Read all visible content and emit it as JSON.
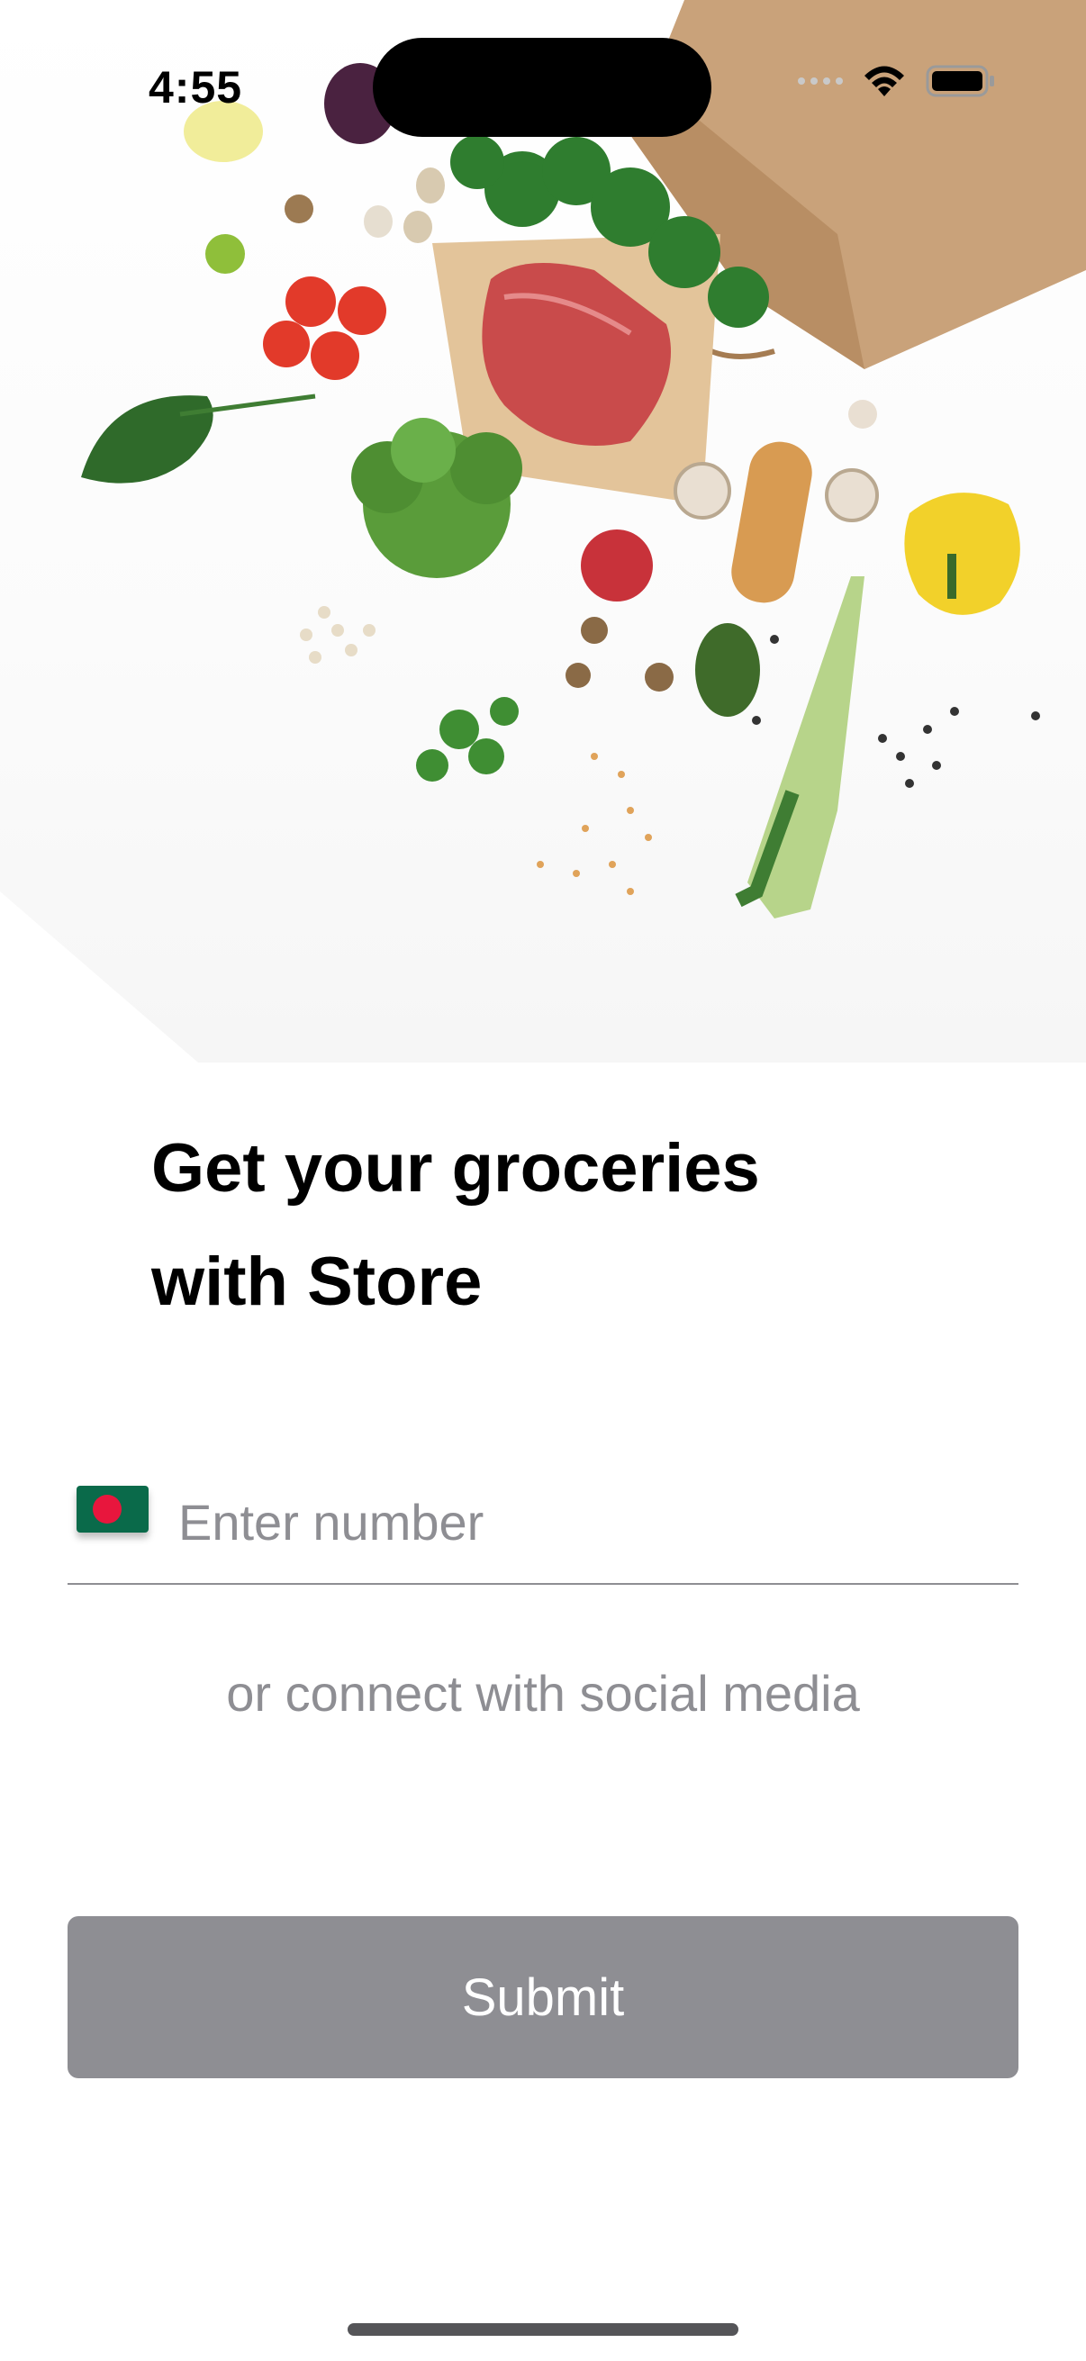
{
  "status_bar": {
    "time": "4:55",
    "icons": [
      "cellular-signal-icon",
      "wifi-icon",
      "battery-icon"
    ]
  },
  "hero": {
    "image": "groceries-illustration"
  },
  "onboarding": {
    "title_line1": "Get your groceries",
    "title_line2": "with Store"
  },
  "phone_field": {
    "placeholder": "Enter number",
    "value": "",
    "country_flag": "bangladesh-flag-icon"
  },
  "social_link_text": "or connect with social media",
  "submit_label": "Submit",
  "colors": {
    "button_disabled": "#8e8e93",
    "placeholder_gray": "#8e8e93",
    "text_primary": "#000000"
  }
}
